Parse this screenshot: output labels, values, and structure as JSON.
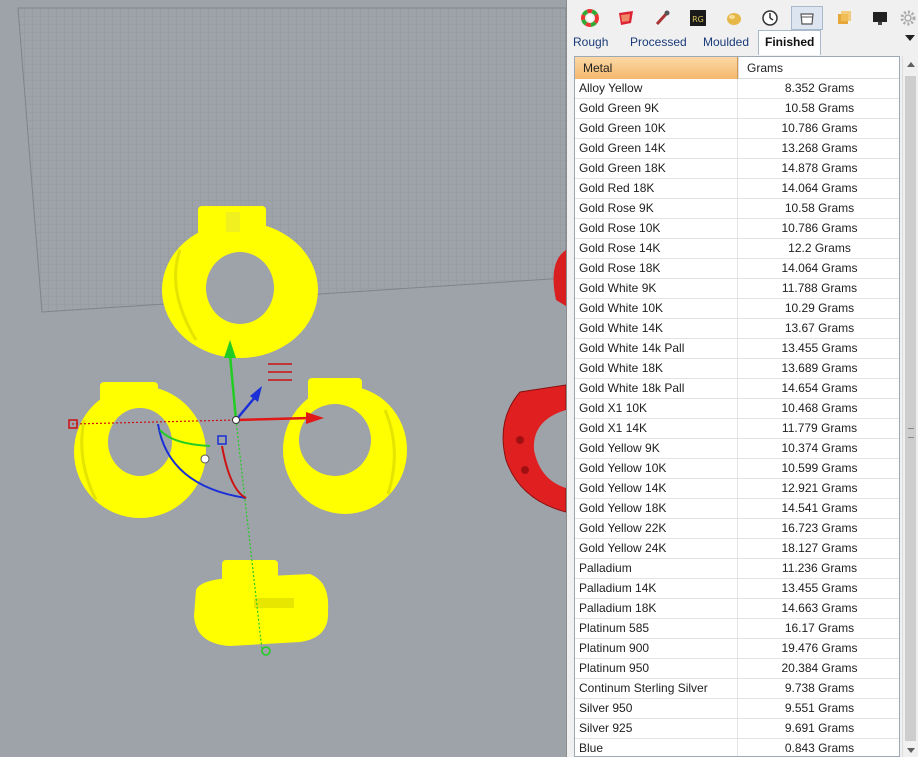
{
  "viewport": {
    "objects_color": "#ffff00",
    "background_color": "#9ea3aa"
  },
  "toolbar": {
    "icons": [
      "color-wheel-icon",
      "material-icon",
      "eyedropper-icon",
      "rg-logo-icon",
      "sphere-icon",
      "clock-icon",
      "ring-icon",
      "cube-icon",
      "monitor-icon",
      "settings-gear-icon"
    ],
    "selected_index": 6
  },
  "tabs": {
    "items": [
      {
        "label": "Rough"
      },
      {
        "label": "Processed"
      },
      {
        "label": "Moulded"
      },
      {
        "label": "Finished"
      }
    ],
    "active_index": 3
  },
  "table": {
    "columns": [
      "Metal",
      "Grams"
    ],
    "rows": [
      {
        "metal": "Alloy Yellow",
        "grams": "8.352 Grams"
      },
      {
        "metal": "Gold Green 9K",
        "grams": "10.58 Grams"
      },
      {
        "metal": "Gold Green 10K",
        "grams": "10.786 Grams"
      },
      {
        "metal": "Gold Green 14K",
        "grams": "13.268 Grams"
      },
      {
        "metal": "Gold Green 18K",
        "grams": "14.878 Grams"
      },
      {
        "metal": "Gold Red 18K",
        "grams": "14.064 Grams"
      },
      {
        "metal": "Gold Rose 9K",
        "grams": "10.58 Grams"
      },
      {
        "metal": "Gold Rose 10K",
        "grams": "10.786 Grams"
      },
      {
        "metal": "Gold Rose 14K",
        "grams": "12.2 Grams"
      },
      {
        "metal": "Gold Rose 18K",
        "grams": "14.064 Grams"
      },
      {
        "metal": "Gold White 9K",
        "grams": "11.788 Grams"
      },
      {
        "metal": "Gold White 10K",
        "grams": "10.29 Grams"
      },
      {
        "metal": "Gold White 14K",
        "grams": "13.67 Grams"
      },
      {
        "metal": "Gold White 14k Pall",
        "grams": "13.455 Grams"
      },
      {
        "metal": "Gold White 18K",
        "grams": "13.689 Grams"
      },
      {
        "metal": "Gold White 18k Pall",
        "grams": "14.654 Grams"
      },
      {
        "metal": "Gold X1 10K",
        "grams": "10.468 Grams"
      },
      {
        "metal": "Gold X1 14K",
        "grams": "11.779 Grams"
      },
      {
        "metal": "Gold Yellow 9K",
        "grams": "10.374 Grams"
      },
      {
        "metal": "Gold Yellow 10K",
        "grams": "10.599 Grams"
      },
      {
        "metal": "Gold Yellow 14K",
        "grams": "12.921 Grams"
      },
      {
        "metal": "Gold Yellow 18K",
        "grams": "14.541 Grams"
      },
      {
        "metal": "Gold Yellow 22K",
        "grams": "16.723 Grams"
      },
      {
        "metal": "Gold Yellow 24K",
        "grams": "18.127 Grams"
      },
      {
        "metal": "Palladium",
        "grams": "11.236 Grams"
      },
      {
        "metal": "Palladium 14K",
        "grams": "13.455 Grams"
      },
      {
        "metal": "Palladium 18K",
        "grams": "14.663 Grams"
      },
      {
        "metal": "Platinum 585",
        "grams": "16.17 Grams"
      },
      {
        "metal": "Platinum 900",
        "grams": "19.476 Grams"
      },
      {
        "metal": "Platinum 950",
        "grams": "20.384 Grams"
      },
      {
        "metal": "Continum Sterling Silver",
        "grams": "9.738 Grams"
      },
      {
        "metal": "Silver 950",
        "grams": "9.551 Grams"
      },
      {
        "metal": "Silver 925",
        "grams": "9.691 Grams"
      },
      {
        "metal": "Blue",
        "grams": "0.843 Grams"
      }
    ]
  }
}
